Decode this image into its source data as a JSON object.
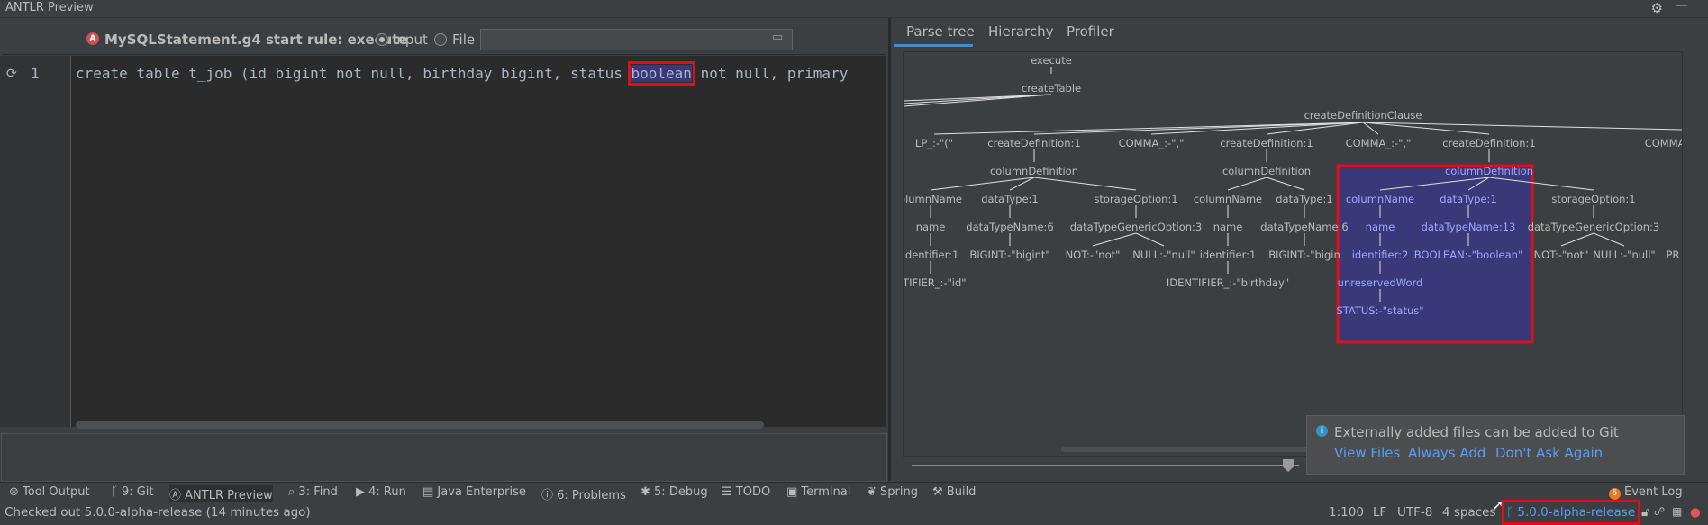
{
  "window": {
    "title": "ANTLR Preview"
  },
  "toolbar": {
    "start_rule": "MySQLStatement.g4 start rule: execute",
    "radio_input": "Input",
    "radio_file": "File",
    "file_path": ""
  },
  "editor": {
    "line_number": "1",
    "code_before": "create table t_job (id bigint not null, birthday bigint, status ",
    "code_highlight": "boolean",
    "code_after": " not null, primary"
  },
  "right_tabs": [
    "Parse tree",
    "Hierarchy",
    "Profiler"
  ],
  "tree": {
    "execute": "execute",
    "createTable": "createTable",
    "cdc": "createDefinitionClause",
    "lp": "LP_:-\"(\"",
    "cd1": "createDefinition:1",
    "comma1": "COMMA_:-\",\"",
    "cd2": "createDefinition:1",
    "comma2": "COMMA_:-\",\"",
    "cd3": "createDefinition:1",
    "comma3": "COMMA_:-",
    "coldef1": "columnDefinition",
    "coldef2": "columnDefinition",
    "coldef3": "columnDefinition",
    "colname1": "olumnName",
    "dt1": "dataType:1",
    "so1": "storageOption:1",
    "colname2": "columnName",
    "dt2": "dataType:1",
    "colname3": "columnName",
    "dt3": "dataType:1",
    "so3": "storageOption:1",
    "name1": "name",
    "dtn1": "dataTypeName:6",
    "dtgo1": "dataTypeGenericOption:3",
    "name2": "name",
    "dtn2": "dataTypeName:6",
    "name3": "name",
    "dtn3": "dataTypeName:13",
    "dtgo3": "dataTypeGenericOption:3",
    "id1": "identifier:1",
    "bigint1": "BIGINT:-\"bigint\"",
    "not1": "NOT:-\"not\"",
    "null1": "NULL:-\"null\"",
    "id2": "identifier:1",
    "bigint2": "BIGINT:-\"bigin",
    "id3": "identifier:2",
    "boolean3": "BOOLEAN:-\"boolean\"",
    "not3": "NOT:-\"not\"",
    "null3": "NULL:-\"null\"",
    "pr": "PR",
    "ident1": "NTIFIER_:-\"id\"",
    "ident2": "IDENTIFIER_:-\"birthday\"",
    "unres": "unreservedWord",
    "status": "STATUS:-\"status\""
  },
  "notification": {
    "message": "Externally added files can be added to Git",
    "link_view": "View Files",
    "link_always": "Always Add",
    "link_dont": "Don't Ask Again"
  },
  "bottom_tools": {
    "tool_output": "Tool Output",
    "git": "9: Git",
    "antlr": "ANTLR Preview",
    "find": "3: Find",
    "run": "4: Run",
    "java_ee": "Java Enterprise",
    "problems": "6: Problems",
    "debug": "5: Debug",
    "todo": "TODO",
    "terminal": "Terminal",
    "spring": "Spring",
    "build": "Build",
    "event_log": "Event Log",
    "event_count": "5"
  },
  "status": {
    "message": "Checked out 5.0.0-alpha-release (14 minutes ago)",
    "position": "1:100",
    "line_sep": "LF",
    "encoding": "UTF-8",
    "indent": "4 spaces",
    "branch": "5.0.0-alpha-release"
  }
}
